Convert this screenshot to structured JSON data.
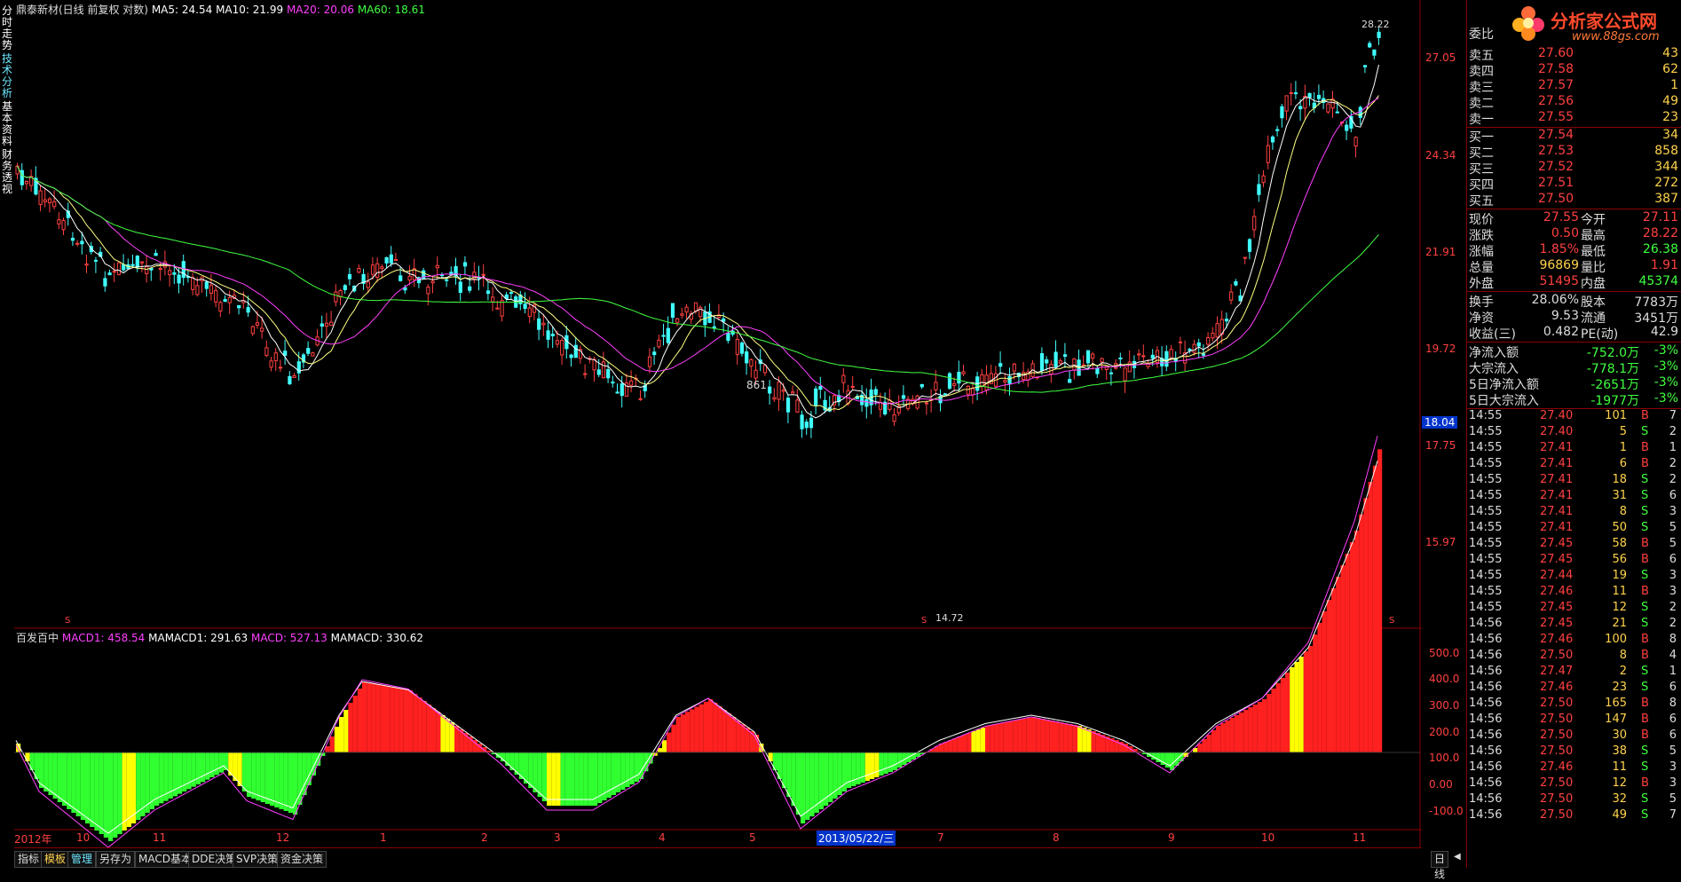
{
  "window": {
    "stock_name_line": "鼎泰新材(日线 前复权 对数)",
    "ma5_label": "MA5: 24.54",
    "ma10_label": "MA10: 21.99",
    "ma20_label": "MA20: 20.06",
    "ma60_label": "MA60: 18.61"
  },
  "left_tabs": [
    "分时走势",
    "技术分析",
    "基本资料",
    "财务透视"
  ],
  "main_chart": {
    "y_ticks": [
      "27.05",
      "24.34",
      "21.91",
      "19.72",
      "17.75",
      "15.97"
    ],
    "current_marker": "18.04",
    "high_label": "28.22",
    "low_label": "14.72",
    "mid_label": "861",
    "s_markers": [
      "S",
      "S",
      "S"
    ]
  },
  "indicator": {
    "name": "百发百中",
    "macd1": "MACD1: 458.54",
    "mamacd1": "MAMACD1: 291.63",
    "macd": "MACD: 527.13",
    "mamacd": "MAMACD: 330.62",
    "y_ticks": [
      "500.0",
      "400.0",
      "300.0",
      "200.0",
      "100.0",
      "0.00",
      "-100.0"
    ]
  },
  "x_axis": {
    "labels": [
      "2012年",
      "10",
      "11",
      "12",
      "1",
      "2",
      "3",
      "4",
      "5",
      "2013/05/22/三",
      "7",
      "8",
      "9",
      "10",
      "11"
    ]
  },
  "bottom_tabs": [
    "指标",
    "模板",
    "管理",
    "另存为",
    "MACD基本",
    "DDE决策",
    "SVP决策",
    "资金决策"
  ],
  "period_label": "日线",
  "logo": {
    "name": "分析家公式网",
    "url": "www.88gs.com"
  },
  "orderbook": {
    "header": "委比",
    "asks": [
      {
        "label": "卖五",
        "price": "27.60",
        "vol": "43"
      },
      {
        "label": "卖四",
        "price": "27.58",
        "vol": "62"
      },
      {
        "label": "卖三",
        "price": "27.57",
        "vol": "1"
      },
      {
        "label": "卖二",
        "price": "27.56",
        "vol": "49"
      },
      {
        "label": "卖一",
        "price": "27.55",
        "vol": "23"
      }
    ],
    "bids": [
      {
        "label": "买一",
        "price": "27.54",
        "vol": "34"
      },
      {
        "label": "买二",
        "price": "27.53",
        "vol": "858"
      },
      {
        "label": "买三",
        "price": "27.52",
        "vol": "344"
      },
      {
        "label": "买四",
        "price": "27.51",
        "vol": "272"
      },
      {
        "label": "买五",
        "price": "27.50",
        "vol": "387"
      }
    ]
  },
  "stats": [
    {
      "l1": "现价",
      "v1": "27.55",
      "c1": "#ff4040",
      "l2": "今开",
      "v2": "27.11",
      "c2": "#ff4040"
    },
    {
      "l1": "涨跌",
      "v1": "0.50",
      "c1": "#ff4040",
      "l2": "最高",
      "v2": "28.22",
      "c2": "#ff4040"
    },
    {
      "l1": "涨幅",
      "v1": "1.85%",
      "c1": "#ff4040",
      "l2": "最低",
      "v2": "26.38",
      "c2": "#40ff40"
    },
    {
      "l1": "总量",
      "v1": "96869",
      "c1": "#ffd34d",
      "l2": "量比",
      "v2": "1.91",
      "c2": "#ff4040"
    },
    {
      "l1": "外盘",
      "v1": "51495",
      "c1": "#ff4040",
      "l2": "内盘",
      "v2": "45374",
      "c2": "#40ff40"
    }
  ],
  "stats2": [
    {
      "l1": "换手",
      "v1": "28.06%",
      "l2": "股本",
      "v2": "7783万"
    },
    {
      "l1": "净资",
      "v1": "9.53",
      "l2": "流通",
      "v2": "3451万"
    },
    {
      "l1": "收益(三)",
      "v1": "0.482",
      "l2": "PE(动)",
      "v2": "42.9"
    }
  ],
  "flows": [
    {
      "label": "净流入额",
      "value": "-752.0万",
      "pct": "-3%"
    },
    {
      "label": "大宗流入",
      "value": "-778.1万",
      "pct": "-3%"
    },
    {
      "label": "5日净流入额",
      "value": "-2651万",
      "pct": "-3%"
    },
    {
      "label": "5日大宗流入",
      "value": "-1977万",
      "pct": "-3%"
    }
  ],
  "ticks": [
    {
      "t": "14:55",
      "p": "27.40",
      "v": "101",
      "s": "B",
      "n": "7"
    },
    {
      "t": "14:55",
      "p": "27.40",
      "v": "5",
      "s": "S",
      "n": "2"
    },
    {
      "t": "14:55",
      "p": "27.41",
      "v": "1",
      "s": "B",
      "n": "1"
    },
    {
      "t": "14:55",
      "p": "27.41",
      "v": "6",
      "s": "B",
      "n": "2"
    },
    {
      "t": "14:55",
      "p": "27.41",
      "v": "18",
      "s": "S",
      "n": "2"
    },
    {
      "t": "14:55",
      "p": "27.41",
      "v": "31",
      "s": "S",
      "n": "6"
    },
    {
      "t": "14:55",
      "p": "27.41",
      "v": "8",
      "s": "S",
      "n": "3"
    },
    {
      "t": "14:55",
      "p": "27.41",
      "v": "50",
      "s": "S",
      "n": "5"
    },
    {
      "t": "14:55",
      "p": "27.45",
      "v": "58",
      "s": "B",
      "n": "5"
    },
    {
      "t": "14:55",
      "p": "27.45",
      "v": "56",
      "s": "B",
      "n": "6"
    },
    {
      "t": "14:55",
      "p": "27.44",
      "v": "19",
      "s": "S",
      "n": "3"
    },
    {
      "t": "14:55",
      "p": "27.46",
      "v": "11",
      "s": "B",
      "n": "3"
    },
    {
      "t": "14:55",
      "p": "27.45",
      "v": "12",
      "s": "S",
      "n": "2"
    },
    {
      "t": "14:56",
      "p": "27.45",
      "v": "21",
      "s": "S",
      "n": "2"
    },
    {
      "t": "14:56",
      "p": "27.46",
      "v": "100",
      "s": "B",
      "n": "8"
    },
    {
      "t": "14:56",
      "p": "27.50",
      "v": "8",
      "s": "B",
      "n": "4"
    },
    {
      "t": "14:56",
      "p": "27.47",
      "v": "2",
      "s": "S",
      "n": "1"
    },
    {
      "t": "14:56",
      "p": "27.46",
      "v": "23",
      "s": "S",
      "n": "6"
    },
    {
      "t": "14:56",
      "p": "27.50",
      "v": "165",
      "s": "B",
      "n": "8"
    },
    {
      "t": "14:56",
      "p": "27.50",
      "v": "147",
      "s": "B",
      "n": "6"
    },
    {
      "t": "14:56",
      "p": "27.50",
      "v": "30",
      "s": "B",
      "n": "6"
    },
    {
      "t": "14:56",
      "p": "27.50",
      "v": "38",
      "s": "S",
      "n": "5"
    },
    {
      "t": "14:56",
      "p": "27.46",
      "v": "11",
      "s": "S",
      "n": "3"
    },
    {
      "t": "14:56",
      "p": "27.50",
      "v": "12",
      "s": "B",
      "n": "3"
    },
    {
      "t": "14:56",
      "p": "27.50",
      "v": "32",
      "s": "S",
      "n": "5"
    },
    {
      "t": "14:56",
      "p": "27.50",
      "v": "49",
      "s": "S",
      "n": "7"
    }
  ],
  "colors": {
    "up": "#ff4040",
    "down": "#40ff40",
    "frame": "#8a0000"
  }
}
